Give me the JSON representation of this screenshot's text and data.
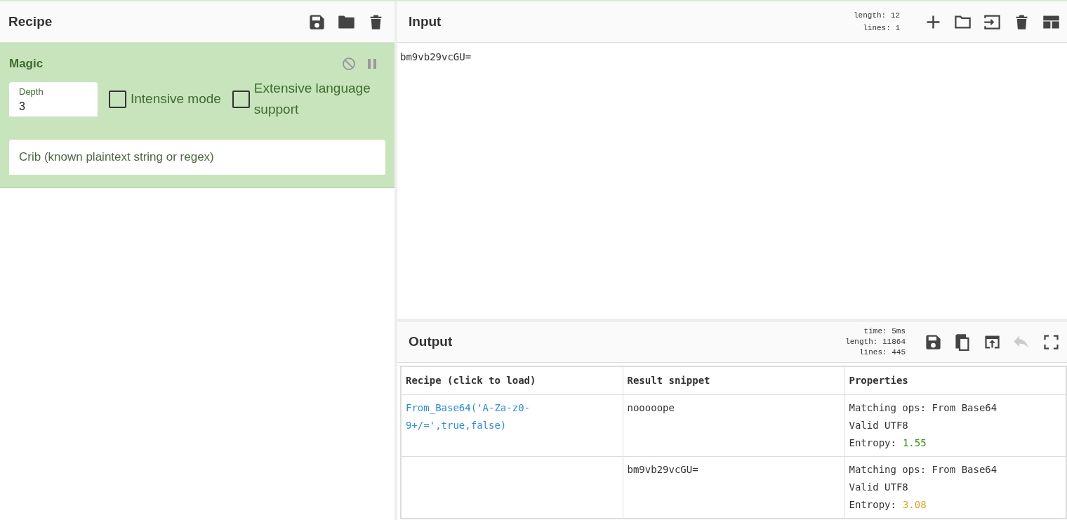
{
  "recipe_panel": {
    "title": "Recipe",
    "buttons": [
      {
        "kind": "save"
      },
      {
        "kind": "folder"
      },
      {
        "kind": "trash"
      }
    ]
  },
  "operation": {
    "name": "Magic",
    "disabled": false,
    "paused": false,
    "depth": {
      "label": "Depth",
      "value": "3"
    },
    "options": [
      {
        "label": "Intensive mode",
        "checked": false
      },
      {
        "label": "Extensive language support",
        "checked": false
      }
    ],
    "crib": {
      "placeholder": "Crib (known plaintext string or regex)"
    }
  },
  "input_panel": {
    "title": "Input",
    "stats": [
      {
        "label": "length:",
        "value": "12"
      },
      {
        "label": "lines:",
        "value": "1"
      }
    ],
    "buttons": [
      {
        "kind": "plus",
        "disabled": false
      },
      {
        "kind": "folder",
        "disabled": false
      },
      {
        "kind": "import",
        "disabled": false
      },
      {
        "kind": "trash",
        "disabled": false
      },
      {
        "kind": "layout",
        "disabled": false
      }
    ],
    "text": "bm9vb29vcGU="
  },
  "output_panel": {
    "title": "Output",
    "stats": [
      {
        "label": "time:",
        "value": "5ms"
      },
      {
        "label": "length:",
        "value": "11864"
      },
      {
        "label": "lines:",
        "value": "445"
      }
    ],
    "buttons": [
      {
        "kind": "save",
        "disabled": false
      },
      {
        "kind": "copy",
        "disabled": false
      },
      {
        "kind": "replace",
        "disabled": false
      },
      {
        "kind": "undo",
        "disabled": true
      },
      {
        "kind": "maximise",
        "disabled": false
      }
    ],
    "table": {
      "columns": [
        "Recipe (click to load)",
        "Result snippet",
        "Properties"
      ],
      "rows": [
        {
          "recipe": "From_Base64('A-Za-z0-9+/=',true,false)",
          "snippet": "nooooope",
          "properties": [
            "Matching ops: From Base64",
            "Valid UTF8"
          ],
          "entropy": {
            "label": "Entropy:",
            "value": "1.55",
            "color": "#3d8a14"
          }
        },
        {
          "snippet": "bm9vb29vcGU=",
          "properties": [
            "Matching ops: From Base64",
            "Valid UTF8"
          ],
          "entropy": {
            "label": "Entropy:",
            "value": "3.08",
            "color": "#e3a52c"
          }
        }
      ]
    }
  }
}
